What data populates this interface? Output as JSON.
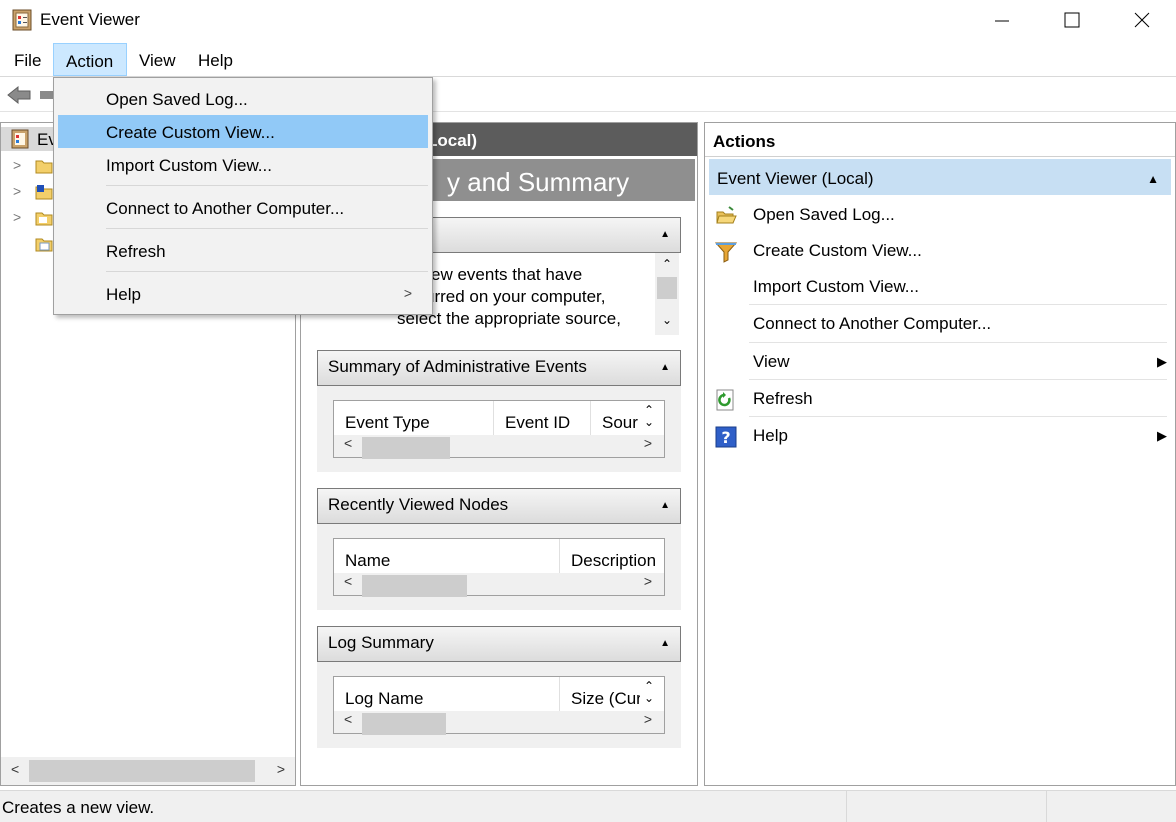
{
  "window": {
    "title": "Event Viewer"
  },
  "menu": [
    "File",
    "Action",
    "View",
    "Help"
  ],
  "dropdown": {
    "items": [
      {
        "label": "Open Saved Log..."
      },
      {
        "label": "Create Custom View..."
      },
      {
        "label": "Import Custom View..."
      },
      {
        "label": "Connect to Another Computer..."
      },
      {
        "label": "Refresh"
      },
      {
        "label": "Help",
        "submenu": ">"
      }
    ]
  },
  "tree": {
    "root_label": "Ev"
  },
  "center": {
    "header": "Local)",
    "title": "y and Summary",
    "overview_text": [
      "ew events that have",
      "urred on your computer,",
      "select the appropriate source,"
    ],
    "sections": [
      {
        "title": "Summary of Administrative Events",
        "columns": [
          "Event Type",
          "Event ID",
          "Sour"
        ]
      },
      {
        "title": "Recently Viewed Nodes",
        "columns": [
          "Name",
          "Description"
        ]
      },
      {
        "title": "Log Summary",
        "columns": [
          "Log Name",
          "Size (Cur"
        ]
      }
    ]
  },
  "actions": {
    "header": "Actions",
    "group": "Event Viewer (Local)",
    "items": [
      {
        "label": "Open Saved Log...",
        "icon": "open-folder-icon"
      },
      {
        "label": "Create Custom View...",
        "icon": "filter-icon"
      },
      {
        "label": "Import Custom View...",
        "icon": ""
      },
      {
        "label": "Connect to Another Computer...",
        "icon": ""
      },
      {
        "label": "View",
        "icon": "",
        "submenu": "▶"
      },
      {
        "label": "Refresh",
        "icon": "refresh-icon"
      },
      {
        "label": "Help",
        "icon": "help-icon",
        "submenu": "▶"
      }
    ]
  },
  "status": {
    "text": "Creates a new view."
  }
}
